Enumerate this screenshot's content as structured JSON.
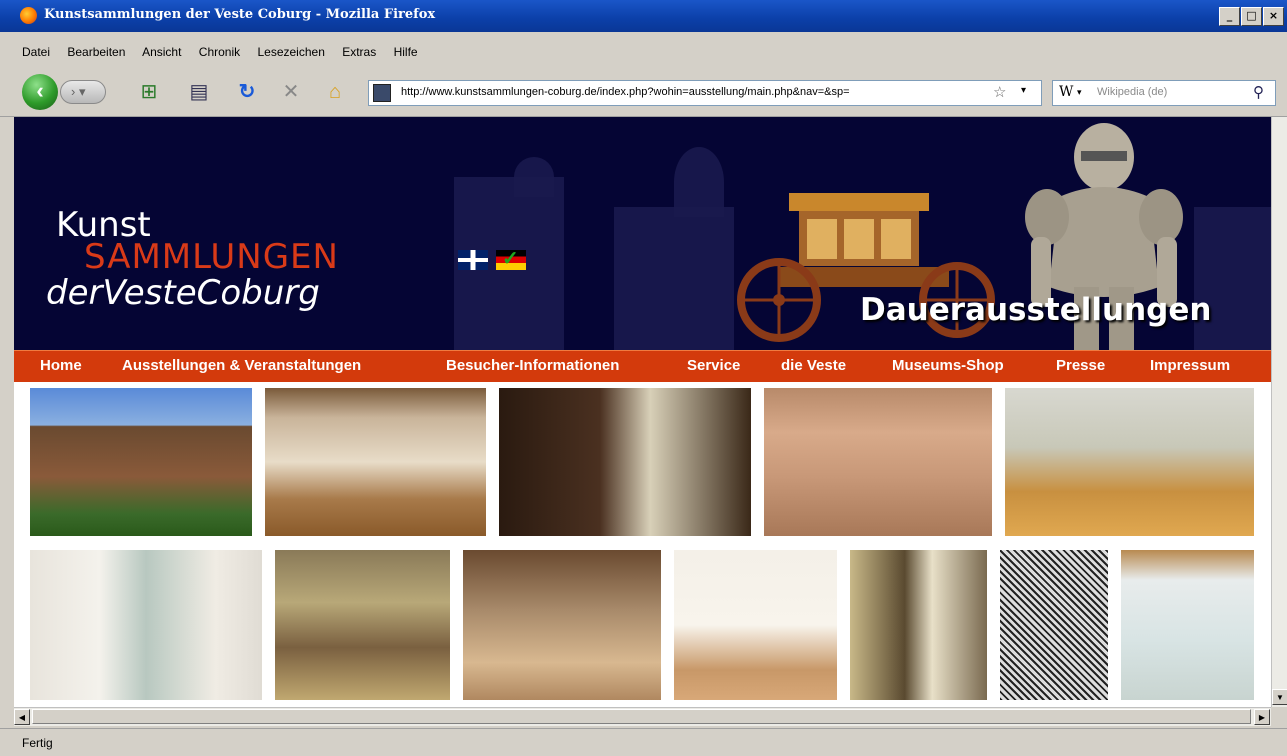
{
  "window": {
    "title": "Kunstsammlungen der Veste Coburg - Mozilla Firefox",
    "btn_min": "_",
    "btn_max": "□",
    "btn_close": "×"
  },
  "menu": [
    "Datei",
    "Bearbeiten",
    "Ansicht",
    "Chronik",
    "Lesezeichen",
    "Extras",
    "Hilfe"
  ],
  "toolbar": {
    "url": "http://www.kunstsammlungen-coburg.de/index.php?wohin=ausstellung/main.php&nav=&sp=",
    "search_engine": "W",
    "search_placeholder": "Wikipedia (de)"
  },
  "banner": {
    "logo_line1": "Kunst",
    "logo_line2": "SAMMLUNGEN",
    "logo_line3": "derVesteCoburg",
    "heading": "Dauerausstellungen"
  },
  "nav": [
    "Home",
    "Ausstellungen & Veranstaltungen",
    "Besucher-Informationen",
    "Service",
    "die Veste",
    "Museums-Shop",
    "Presse",
    "Impressum"
  ],
  "status": {
    "text": "Fertig"
  }
}
